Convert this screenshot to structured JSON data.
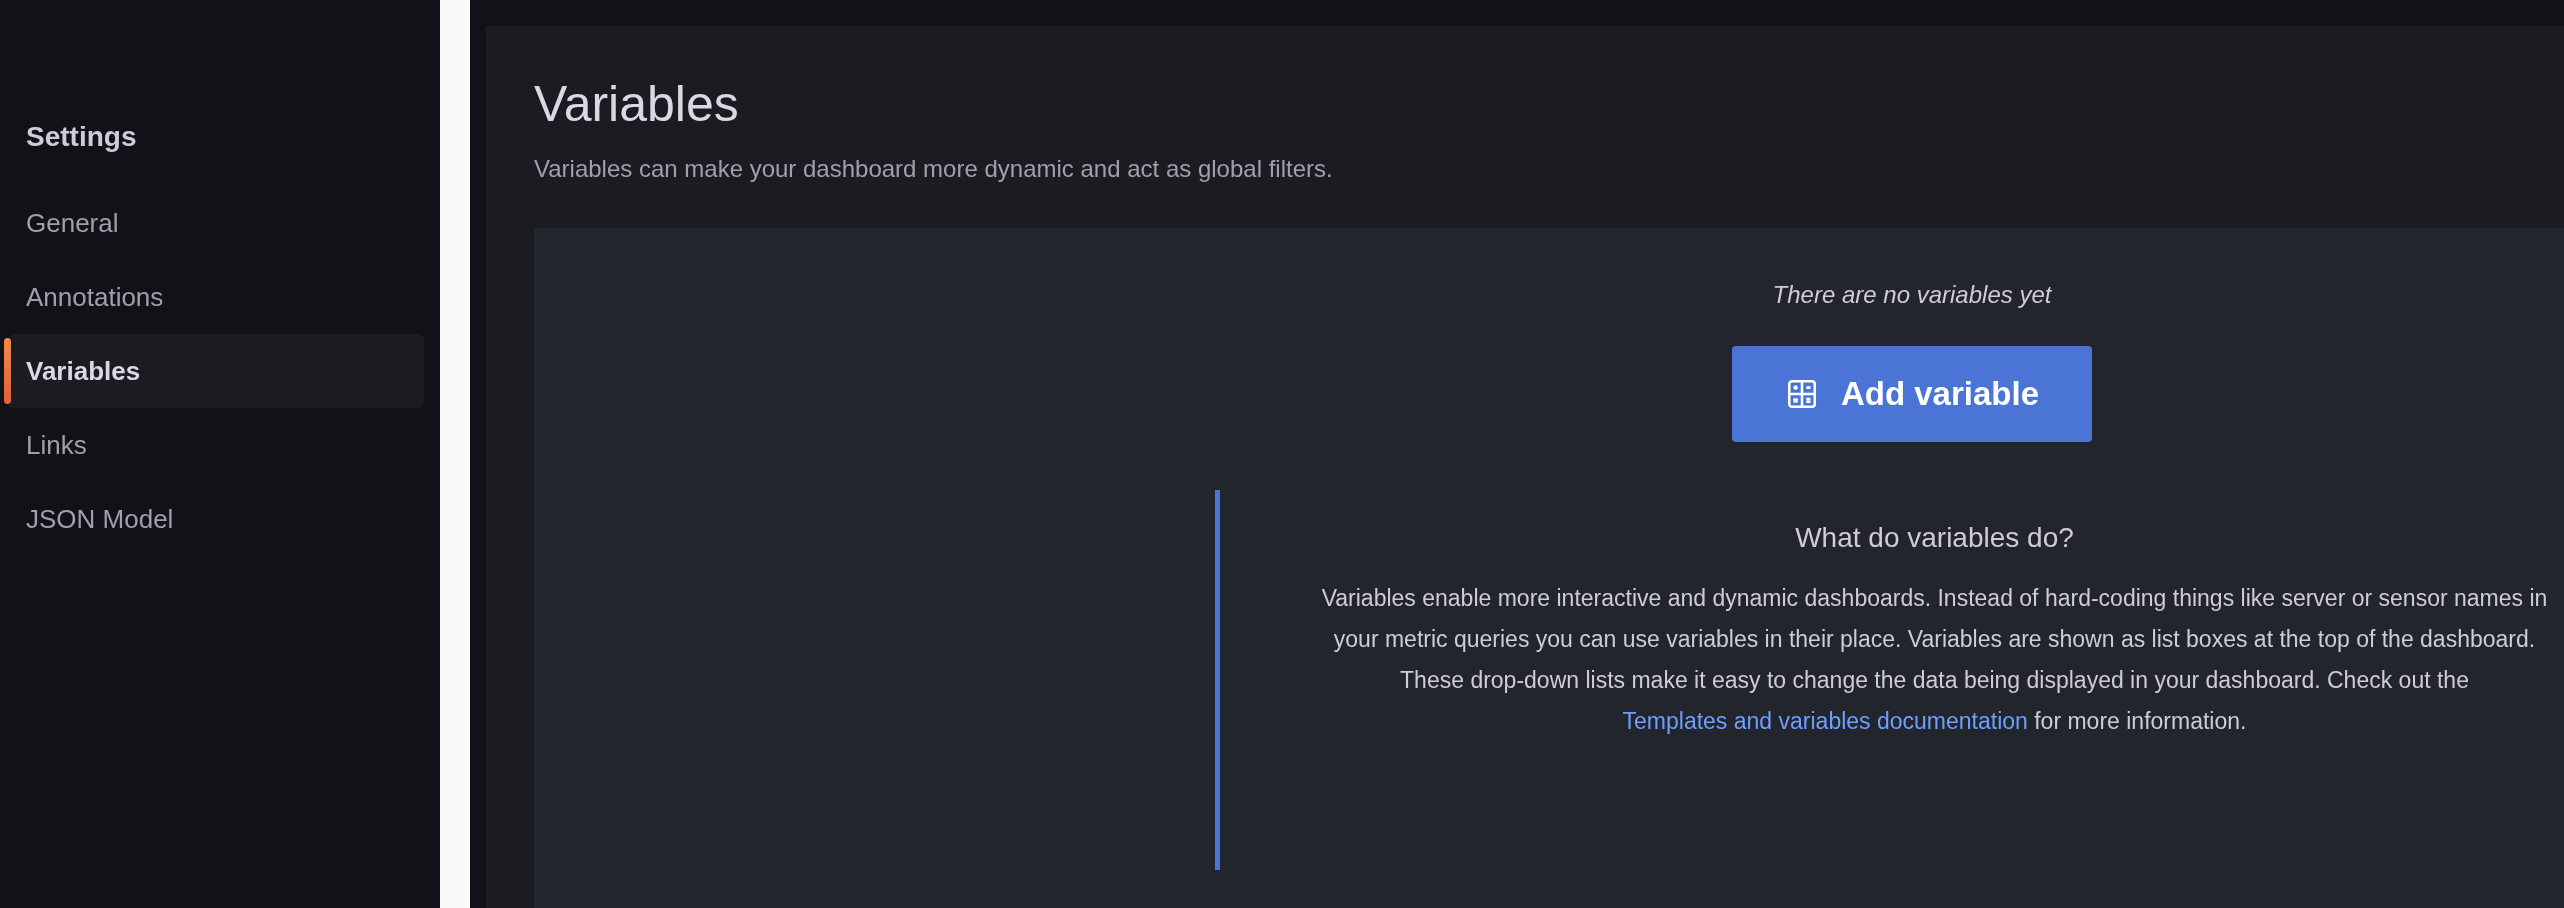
{
  "sidebar": {
    "title": "Settings",
    "items": [
      {
        "label": "General",
        "selected": false
      },
      {
        "label": "Annotations",
        "selected": false
      },
      {
        "label": "Variables",
        "selected": true
      },
      {
        "label": "Links",
        "selected": false
      },
      {
        "label": "JSON Model",
        "selected": false
      }
    ]
  },
  "page": {
    "title": "Variables",
    "subtitle": "Variables can make your dashboard more dynamic and act as global filters."
  },
  "empty_state": {
    "message": "There are no variables yet",
    "button": "Add variable"
  },
  "help": {
    "title": "What do variables do?",
    "text_before": "Variables enable more interactive and dynamic dashboards. Instead of hard-coding things like server or sensor names in your metric queries you can use variables in their place. Variables are shown as list boxes at the top of the dashboard. These drop-down lists make it easy to change the data being displayed in your dashboard. Check out the",
    "link": "Templates and variables documentation",
    "text_after": "for more information."
  }
}
